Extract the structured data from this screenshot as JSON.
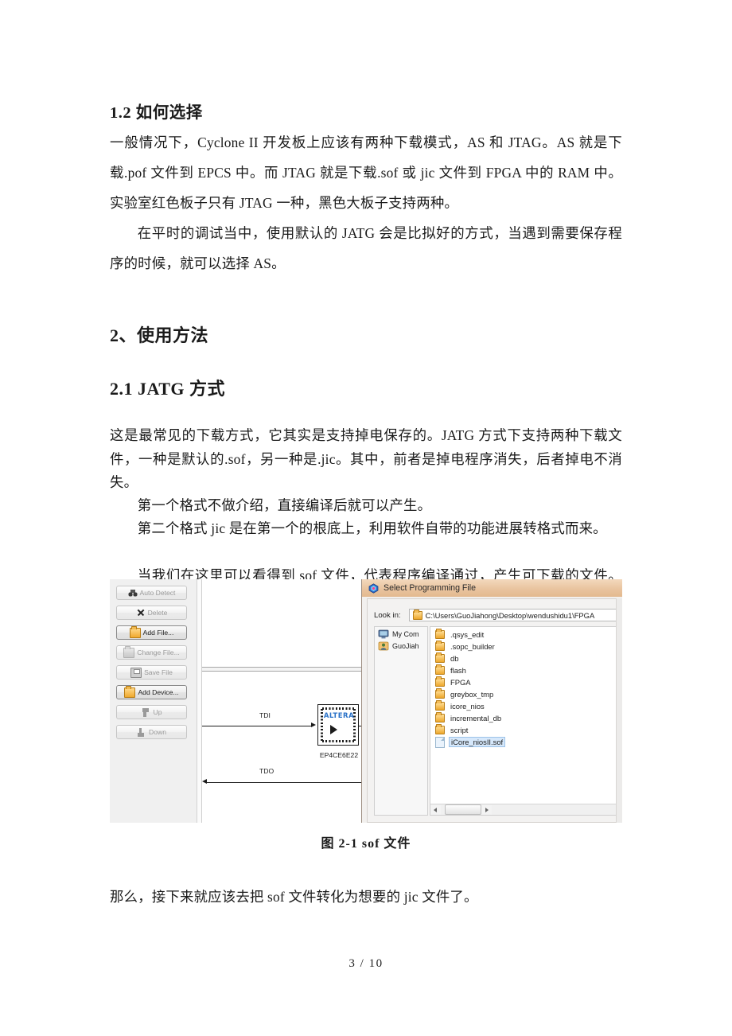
{
  "document": {
    "sections": [
      {
        "id": "sec-1-2",
        "heading": "1.2 如何选择",
        "paragraphs": [
          " 一般情况下，Cyclone II 开发板上应该有两种下载模式，AS 和 JTAG。AS 就是下载.pof 文件到 EPCS 中。而 JTAG 就是下载.sof 或 jic 文件到 FPGA 中的 RAM 中。实验室红色板子只有 JTAG 一种，黑色大板子支持两种。",
          "在平时的调试当中，使用默认的 JATG 会是比拟好的方式，当遇到需要保存程序的时候，就可以选择 AS。"
        ]
      },
      {
        "id": "sec-2",
        "heading": "2、使用方法"
      },
      {
        "id": "sec-2-1",
        "heading": "2.1 JATG 方式",
        "paragraphs": [
          "这是最常见的下载方式，它其实是支持掉电保存的。JATG 方式下支持两种下载文件，一种是默认的.sof，另一种是.jic。其中，前者是掉电程序消失，后者掉电不消失。",
          "第一个格式不做介绍，直接编译后就可以产生。",
          "第二个格式 jic 是在第一个的根底上，利用软件自带的功能进展转格式而来。",
          "当我们在这里可以看得到 sof 文件，代表程序编译通过，产生可下载的文件。这里我们以黑色的开发板为例子，进展讲解。"
        ]
      }
    ],
    "figure_caption": "图 2-1   sof 文件",
    "closing_paragraph": "那么，接下来就应该去把 sof 文件转化为想要的 jic 文件了。",
    "footer": "3 / 10"
  },
  "screenshot": {
    "programmer_buttons": [
      {
        "label": "Auto Detect",
        "icon": "binoculars-icon",
        "enabled": false
      },
      {
        "label": "Delete",
        "icon": "x-cross-icon",
        "enabled": false
      },
      {
        "label": "Add File...",
        "icon": "open-folder-icon",
        "enabled": true
      },
      {
        "label": "Change File...",
        "icon": "folder-hand-icon",
        "enabled": false
      },
      {
        "label": "Save File",
        "icon": "floppy-disk-icon",
        "enabled": false
      },
      {
        "label": "Add Device...",
        "icon": "add-device-icon",
        "enabled": true
      },
      {
        "label": "Up",
        "icon": "arrow-up-icon",
        "enabled": false
      },
      {
        "label": "Down",
        "icon": "arrow-down-icon",
        "enabled": false
      }
    ],
    "chain_diagram": {
      "chip_brand": "ALTERA",
      "chip_part": "EP4CE6E22",
      "input_signal": "TDI",
      "output_signal": "TDO"
    },
    "dialog": {
      "title": "Select Programming File",
      "title_icon": "quartus-icon",
      "lookin_label": "Look in:",
      "lookin_path": "C:\\Users\\GuoJiahong\\Desktop\\wendushidu1\\FPGA",
      "places": [
        {
          "label": "My Com",
          "icon": "computer-icon"
        },
        {
          "label": "GuoJiah",
          "icon": "user-icon"
        }
      ],
      "files": [
        {
          "name": ".qsys_edit",
          "type": "folder",
          "selected": false
        },
        {
          "name": ".sopc_builder",
          "type": "folder",
          "selected": false
        },
        {
          "name": "db",
          "type": "folder",
          "selected": false
        },
        {
          "name": "flash",
          "type": "folder",
          "selected": false
        },
        {
          "name": "FPGA",
          "type": "folder",
          "selected": false
        },
        {
          "name": "greybox_tmp",
          "type": "folder",
          "selected": false
        },
        {
          "name": "icore_nios",
          "type": "folder",
          "selected": false
        },
        {
          "name": "incremental_db",
          "type": "folder",
          "selected": false
        },
        {
          "name": "script",
          "type": "folder",
          "selected": false
        },
        {
          "name": "iCore_niosII.sof",
          "type": "file",
          "selected": true
        }
      ],
      "titlebar_color": "#e9c49f",
      "selection_color": "#d6e8fb"
    }
  }
}
